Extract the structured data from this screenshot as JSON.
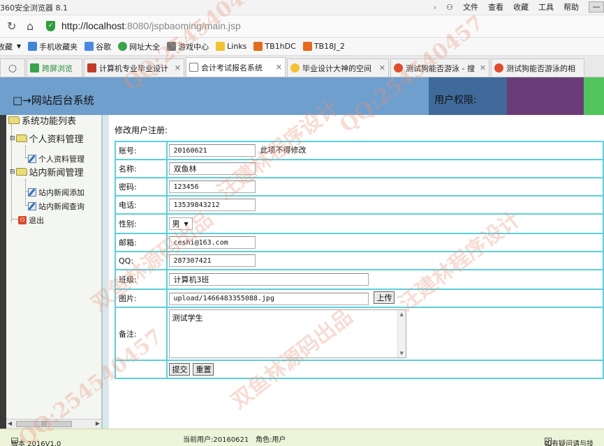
{
  "browser": {
    "app_title": "360安全浏览器 8.1",
    "menus": [
      "文件",
      "查看",
      "收藏",
      "工具",
      "帮助"
    ],
    "url_host": "http://localhost",
    "url_rest": ":8080/jspbaoming/main.jsp",
    "favorites": [
      {
        "label": "收藏",
        "color": "#f2c232"
      },
      {
        "label": "手机收藏夹",
        "color": "#3f86d8"
      },
      {
        "label": "谷歌",
        "color": "#4a8bdf"
      },
      {
        "label": "网址大全",
        "color": "#39a44b"
      },
      {
        "label": "游戏中心",
        "color": "#777777"
      },
      {
        "label": "Links",
        "color": "#f2c232"
      },
      {
        "label": "TB1hDC",
        "color": "#e46a1f"
      },
      {
        "label": "TB18J_2",
        "color": "#e46a1f"
      }
    ],
    "tabs": [
      {
        "label": "跨屏浏览",
        "color": "#39a44b",
        "close": false,
        "active": false
      },
      {
        "label": "计算机专业毕业设计",
        "color": "#c33a2b",
        "close": true,
        "active": false
      },
      {
        "label": "会计考试报名系统",
        "color": "#8a8a8a",
        "close": true,
        "active": true
      },
      {
        "label": "毕业设计大神的空间",
        "color": "#f2c232",
        "close": true,
        "active": false
      },
      {
        "label": "测试狗能否游泳 - 搜",
        "color": "#e04b2c",
        "close": true,
        "active": false
      },
      {
        "label": "测试狗能否游泳的相",
        "color": "#e04b2c",
        "close": true,
        "active": false
      }
    ]
  },
  "header": {
    "title": "□→网站后台系统",
    "permission": "用户权限:"
  },
  "sidebar": {
    "root": "系统功能列表",
    "group1": "个人资料管理",
    "group1_item": "个人资料管理",
    "group2": "站内新闻管理",
    "group2_item1": "站内新闻添加",
    "group2_item2": "站内新闻查询",
    "exit": "退出"
  },
  "form": {
    "caption": "修改用户注册:",
    "rows": {
      "account": {
        "label": "账号:",
        "value": "20160621",
        "note": "此项不得修改"
      },
      "name": {
        "label": "名称:",
        "value": "双鱼林"
      },
      "password": {
        "label": "密码:",
        "value": "123456"
      },
      "phone": {
        "label": "电话:",
        "value": "13539843212"
      },
      "gender": {
        "label": "性别:",
        "value": "男"
      },
      "email": {
        "label": "邮箱:",
        "value": "ceshi@163.com"
      },
      "qq": {
        "label": "QQ:",
        "value": "287307421"
      },
      "class": {
        "label": "班级:",
        "value": "计算机3班"
      },
      "image": {
        "label": "图片:",
        "value": "upload/1466483355088.jpg",
        "button": "上传"
      },
      "remark": {
        "label": "备注:",
        "value": "测试学生"
      }
    },
    "submit": "提交",
    "reset": "重置"
  },
  "status": {
    "version": "版本 2016V1.0",
    "current_user": "当前用户:20160621",
    "role": "角色:用户",
    "help": "如有疑问请与技"
  },
  "watermarks": [
    "QQ:254540457",
    "汪建林程序设计",
    "双鱼林源码出品"
  ]
}
